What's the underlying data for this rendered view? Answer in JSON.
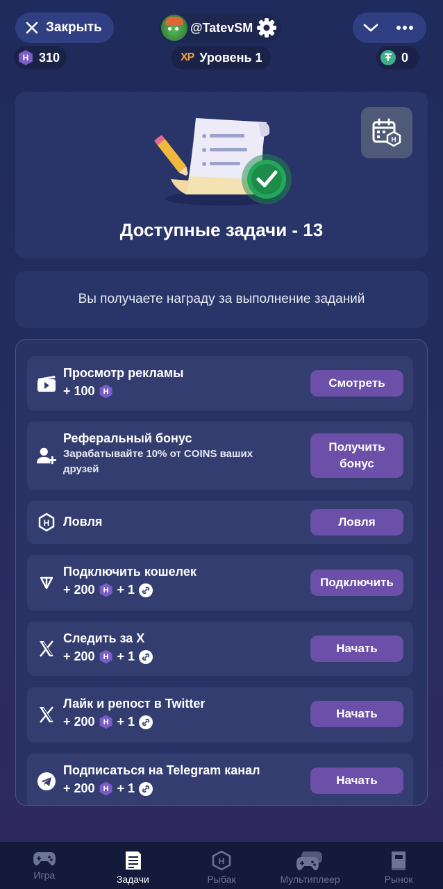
{
  "header": {
    "close_label": "Закрыть",
    "username": "@TatevSM",
    "coins_count": "310",
    "xp_badge": "XP",
    "level_label": "Уровень 1",
    "usdt_count": "0"
  },
  "hero": {
    "title": "Доступные задачи - 13",
    "subtitle": "Вы получаете награду за выполнение заданий"
  },
  "coin_symbol": "H",
  "tasks": [
    {
      "title": "Просмотр рекламы",
      "reward": "+ 100",
      "button": "Смотреть",
      "icon": "video-icon"
    },
    {
      "title": "Реферальный бонус",
      "description": "Зарабатывайте 10% от COINS ваших друзей",
      "button": "Получить бонус",
      "icon": "add-user-icon"
    },
    {
      "title": "Ловля",
      "button": "Ловля",
      "icon": "hex-coin-icon"
    },
    {
      "title": "Подключить кошелек",
      "reward": "+ 200",
      "reward2": "+ 1",
      "button": "Подключить",
      "icon": "ton-icon"
    },
    {
      "title": "Следить за X",
      "reward": "+ 200",
      "reward2": "+ 1",
      "button": "Начать",
      "icon": "x-logo-icon"
    },
    {
      "title": "Лайк и репост в Twitter",
      "reward": "+ 200",
      "reward2": "+ 1",
      "button": "Начать",
      "icon": "x-logo-icon"
    },
    {
      "title": "Подписаться на Telegram канал",
      "reward": "+ 200",
      "reward2": "+ 1",
      "button": "Начать",
      "icon": "telegram-icon"
    }
  ],
  "nav": [
    {
      "label": "Игра",
      "icon": "gamepad-icon"
    },
    {
      "label": "Задачи",
      "icon": "document-icon",
      "active": true
    },
    {
      "label": "Рыбак",
      "icon": "hex-coin-icon"
    },
    {
      "label": "Мультиплеер",
      "icon": "multi-gamepad-icon"
    },
    {
      "label": "Рынок",
      "icon": "book-icon"
    }
  ],
  "colors": {
    "background": "#222c5e",
    "card": "#293468",
    "button_purple": "#6b4fa8",
    "xp_orange": "#f2a33c",
    "usdt_green": "#3fae8a"
  }
}
